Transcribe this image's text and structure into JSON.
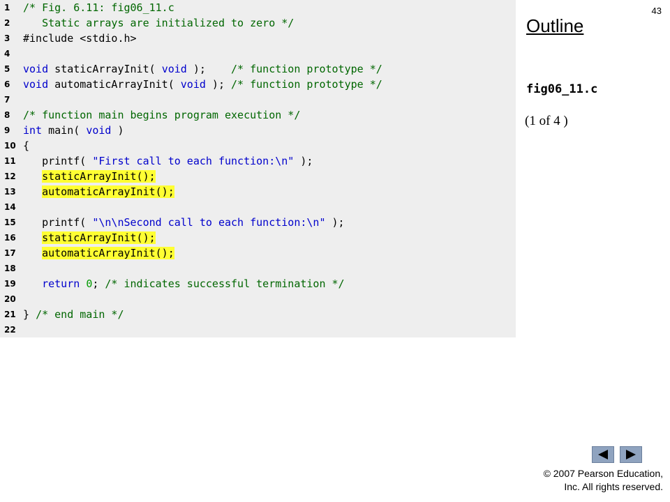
{
  "slide_number": "43",
  "outline": {
    "title": "Outline",
    "file_name": "fig06_11.c",
    "page": "(1 of 4 )"
  },
  "code": {
    "lines": [
      {
        "n": "1",
        "tokens": [
          {
            "t": "/* Fig. 6.11: fig06_11.c",
            "k": "comment"
          }
        ]
      },
      {
        "n": "2",
        "tokens": [
          {
            "t": "   Static arrays are initialized to zero */",
            "k": "comment"
          }
        ]
      },
      {
        "n": "3",
        "tokens": [
          {
            "t": "#include <stdio.h>",
            "k": "plain"
          }
        ]
      },
      {
        "n": "4",
        "tokens": []
      },
      {
        "n": "5",
        "tokens": [
          {
            "t": "void",
            "k": "keyword"
          },
          {
            "t": " staticArrayInit( ",
            "k": "plain"
          },
          {
            "t": "void",
            "k": "keyword"
          },
          {
            "t": " );    ",
            "k": "plain"
          },
          {
            "t": "/* function prototype */",
            "k": "comment"
          }
        ]
      },
      {
        "n": "6",
        "tokens": [
          {
            "t": "void",
            "k": "keyword"
          },
          {
            "t": " automaticArrayInit( ",
            "k": "plain"
          },
          {
            "t": "void",
            "k": "keyword"
          },
          {
            "t": " ); ",
            "k": "plain"
          },
          {
            "t": "/* function prototype */",
            "k": "comment"
          }
        ]
      },
      {
        "n": "7",
        "tokens": []
      },
      {
        "n": "8",
        "tokens": [
          {
            "t": "/* function main begins program execution */",
            "k": "comment"
          }
        ]
      },
      {
        "n": "9",
        "tokens": [
          {
            "t": "int",
            "k": "keyword"
          },
          {
            "t": " main( ",
            "k": "plain"
          },
          {
            "t": "void",
            "k": "keyword"
          },
          {
            "t": " )",
            "k": "plain"
          }
        ]
      },
      {
        "n": "10",
        "tokens": [
          {
            "t": "{",
            "k": "plain"
          }
        ]
      },
      {
        "n": "11",
        "tokens": [
          {
            "t": "   printf( ",
            "k": "plain"
          },
          {
            "t": "\"First call to each function:\\n\"",
            "k": "string"
          },
          {
            "t": " );",
            "k": "plain"
          }
        ]
      },
      {
        "n": "12",
        "tokens": [
          {
            "t": "   ",
            "k": "plain"
          },
          {
            "t": "staticArrayInit();",
            "k": "hl"
          }
        ]
      },
      {
        "n": "13",
        "tokens": [
          {
            "t": "   ",
            "k": "plain"
          },
          {
            "t": "automaticArrayInit();",
            "k": "hl"
          }
        ]
      },
      {
        "n": "14",
        "tokens": []
      },
      {
        "n": "15",
        "tokens": [
          {
            "t": "   printf( ",
            "k": "plain"
          },
          {
            "t": "\"\\n\\nSecond call to each function:\\n\"",
            "k": "string"
          },
          {
            "t": " );",
            "k": "plain"
          }
        ]
      },
      {
        "n": "16",
        "tokens": [
          {
            "t": "   ",
            "k": "plain"
          },
          {
            "t": "staticArrayInit();",
            "k": "hl"
          }
        ]
      },
      {
        "n": "17",
        "tokens": [
          {
            "t": "   ",
            "k": "plain"
          },
          {
            "t": "automaticArrayInit();",
            "k": "hl"
          }
        ]
      },
      {
        "n": "18",
        "tokens": []
      },
      {
        "n": "19",
        "tokens": [
          {
            "t": "   ",
            "k": "plain"
          },
          {
            "t": "return",
            "k": "keyword"
          },
          {
            "t": " ",
            "k": "plain"
          },
          {
            "t": "0",
            "k": "number"
          },
          {
            "t": "; ",
            "k": "plain"
          },
          {
            "t": "/* indicates successful termination */",
            "k": "comment"
          }
        ]
      },
      {
        "n": "20",
        "tokens": []
      },
      {
        "n": "21",
        "tokens": [
          {
            "t": "} ",
            "k": "plain"
          },
          {
            "t": "/* end main */",
            "k": "comment"
          }
        ]
      },
      {
        "n": "22",
        "tokens": []
      }
    ]
  },
  "navigation": {
    "prev_icon": "triangle-left-icon",
    "next_icon": "triangle-right-icon"
  },
  "copyright": {
    "line1": "© 2007 Pearson Education,",
    "line2": "Inc.  All rights reserved."
  },
  "colors": {
    "code_background": "#eeeeee",
    "comment": "#006600",
    "keyword": "#0000cc",
    "highlight": "#ffff33",
    "nav_button": "#8fa3bf"
  }
}
